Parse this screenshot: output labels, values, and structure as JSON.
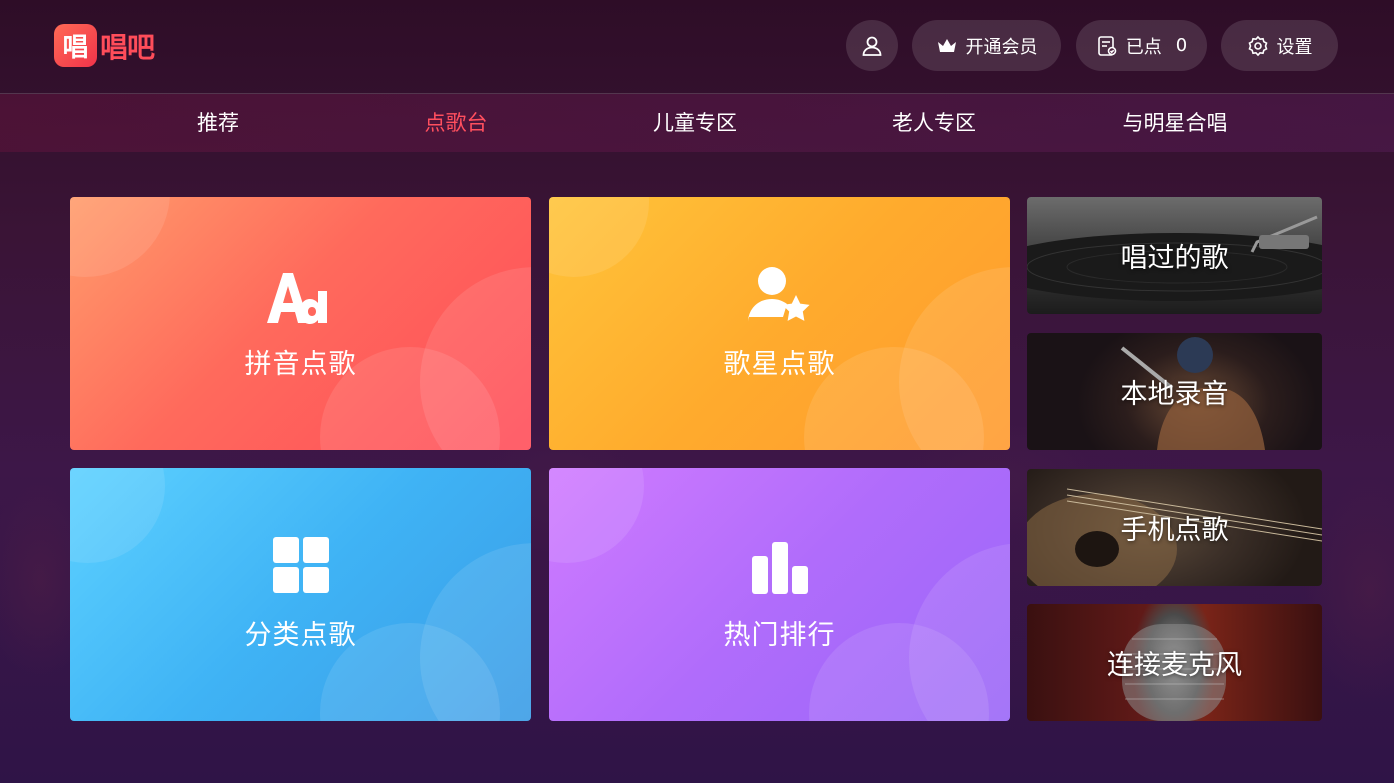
{
  "app": {
    "logo_badge": "唱",
    "logo_text": "唱吧"
  },
  "header": {
    "user_icon": "user-icon",
    "vip_label": "开通会员",
    "queue_label": "已点",
    "queue_count": "0",
    "settings_label": "设置"
  },
  "nav": {
    "tabs": [
      {
        "label": "推荐"
      },
      {
        "label": "点歌台"
      },
      {
        "label": "儿童专区"
      },
      {
        "label": "老人专区"
      },
      {
        "label": "与明星合唱"
      }
    ],
    "active_index": 1
  },
  "main": {
    "cards": [
      {
        "label": "拼音点歌",
        "icon": "letters-aa-icon"
      },
      {
        "label": "歌星点歌",
        "icon": "singer-star-icon"
      },
      {
        "label": "分类点歌",
        "icon": "grid-icon"
      },
      {
        "label": "热门排行",
        "icon": "bar-chart-icon"
      }
    ],
    "tiles": [
      {
        "label": "唱过的歌"
      },
      {
        "label": "本地录音"
      },
      {
        "label": "手机点歌"
      },
      {
        "label": "连接麦克风"
      }
    ]
  },
  "colors": {
    "accent": "#ff4f5e",
    "pinyin_card": "#ff6a5c",
    "singer_card": "#ffab2d",
    "category_card": "#3fb3f5",
    "hot_card": "#b06cfb"
  }
}
